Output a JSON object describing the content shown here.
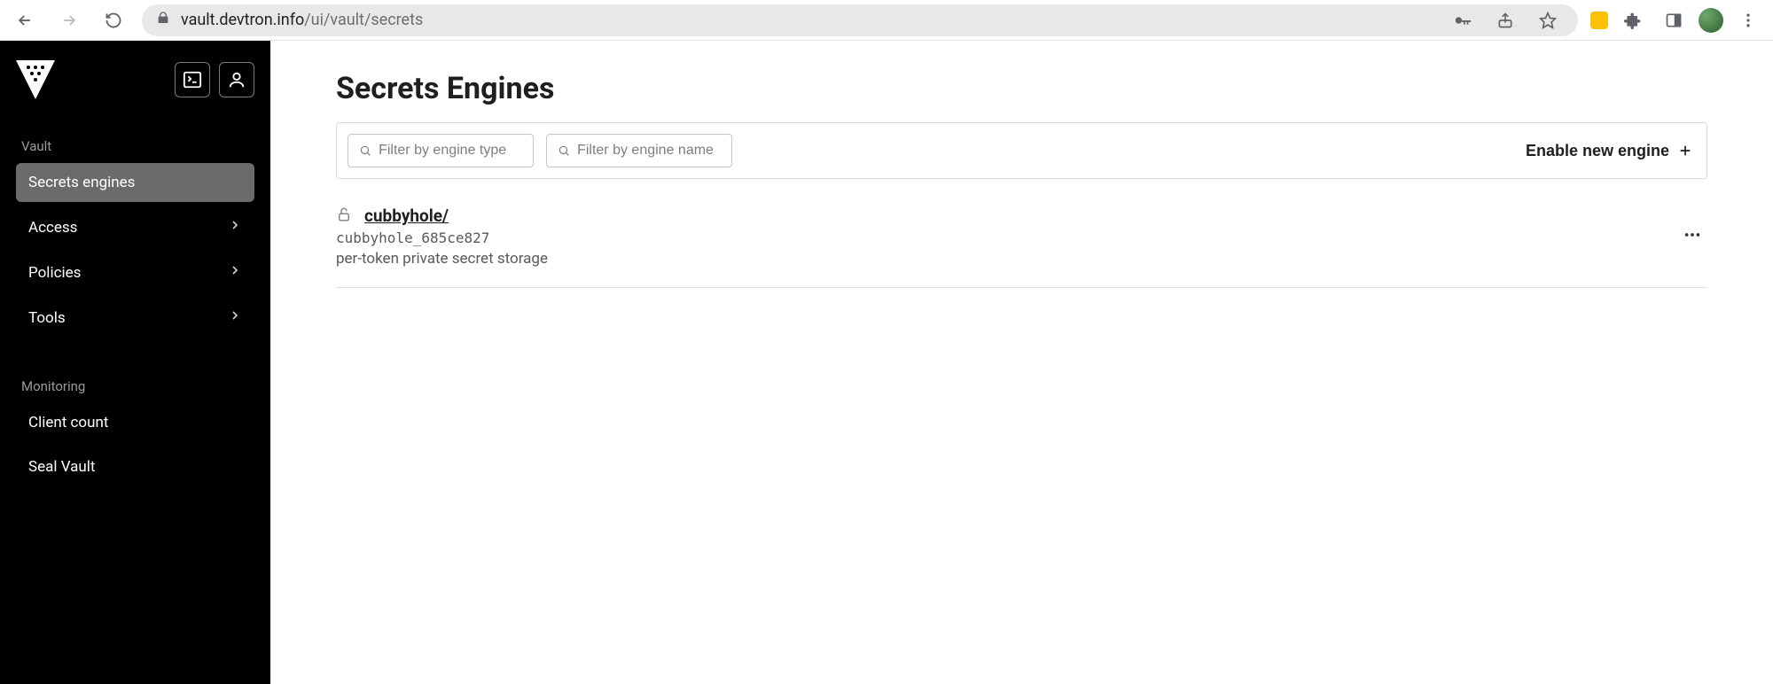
{
  "browser": {
    "url_host": "vault.devtron.info",
    "url_path": "/ui/vault/secrets"
  },
  "sidebar": {
    "section1_label": "Vault",
    "items1": [
      {
        "label": "Secrets engines",
        "chevron": false,
        "active": true,
        "name": "secrets-engines"
      },
      {
        "label": "Access",
        "chevron": true,
        "active": false,
        "name": "access"
      },
      {
        "label": "Policies",
        "chevron": true,
        "active": false,
        "name": "policies"
      },
      {
        "label": "Tools",
        "chevron": true,
        "active": false,
        "name": "tools"
      }
    ],
    "section2_label": "Monitoring",
    "items2": [
      {
        "label": "Client count",
        "chevron": false,
        "active": false,
        "name": "client-count"
      },
      {
        "label": "Seal Vault",
        "chevron": false,
        "active": false,
        "name": "seal-vault"
      }
    ]
  },
  "main": {
    "title": "Secrets Engines",
    "filter_type_placeholder": "Filter by engine type",
    "filter_name_placeholder": "Filter by engine name",
    "enable_button": "Enable new engine",
    "engines": [
      {
        "name": "cubbyhole/",
        "accessor": "cubbyhole_685ce827",
        "description": "per-token private secret storage"
      }
    ]
  }
}
